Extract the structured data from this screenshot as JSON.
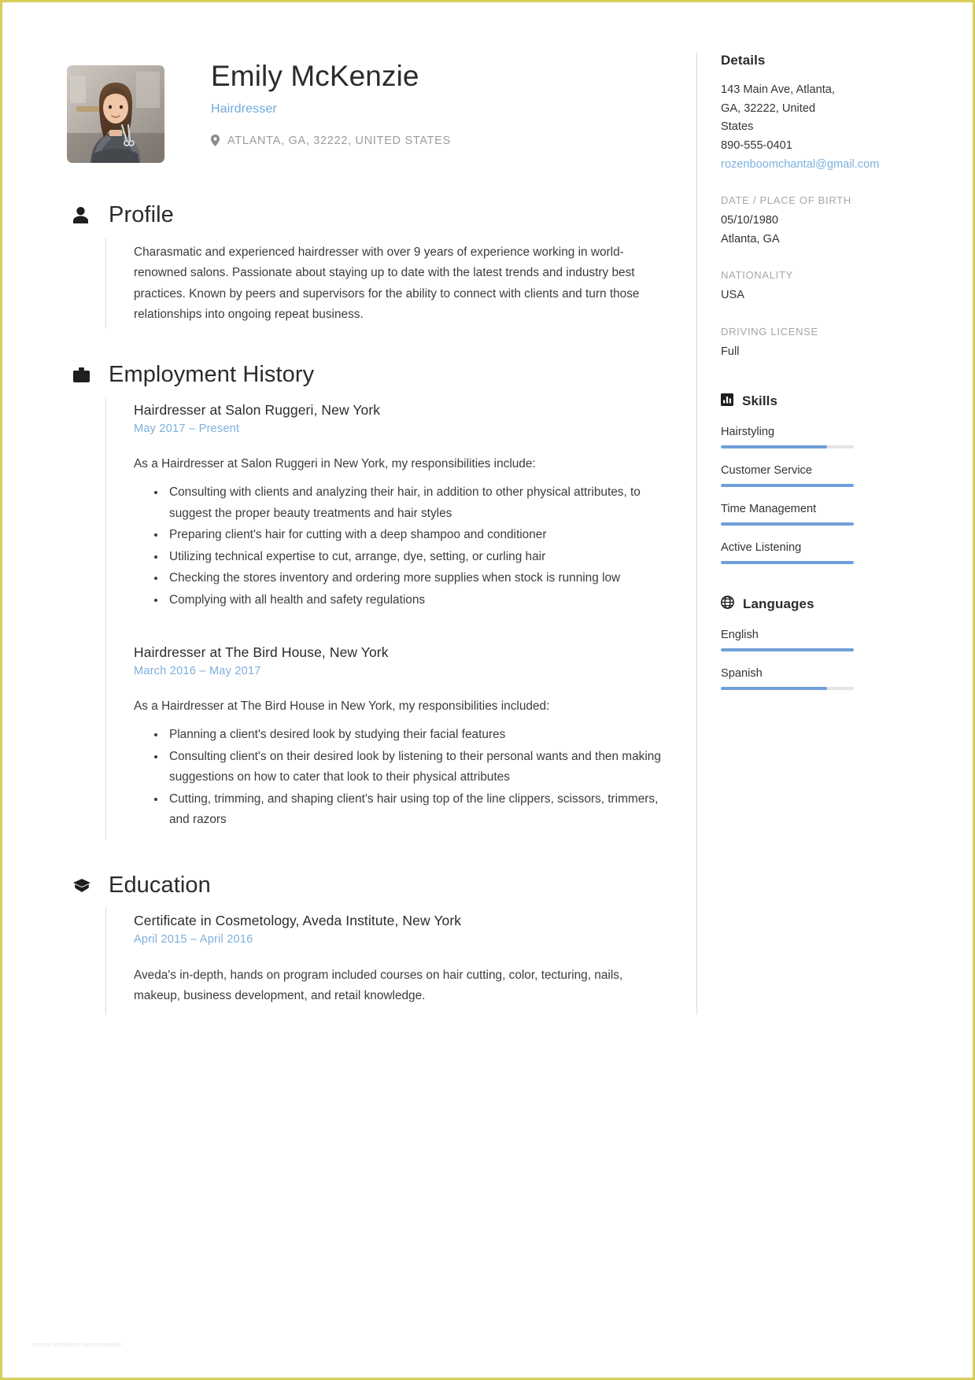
{
  "header": {
    "name": "Emily McKenzie",
    "job_title": "Hairdresser",
    "location": "ATLANTA, GA, 32222, UNITED STATES",
    "photo_alt": "portrait-photo"
  },
  "sections": {
    "profile": {
      "title": "Profile",
      "icon": "person-icon",
      "text": "Charasmatic and experienced hairdresser with over 9 years of experience working in world-renowned salons. Passionate about staying up to date with the latest trends and industry best practices. Known by peers and supervisors for the ability to connect with clients and turn those relationships into ongoing repeat business."
    },
    "employment": {
      "title": "Employment History",
      "icon": "briefcase-icon",
      "entries": [
        {
          "title": "Hairdresser at Salon Ruggeri, New York",
          "start": "May 2017",
          "dash": "–",
          "end": "Present",
          "lead": "As a Hairdresser at Salon Ruggeri in New York, my responsibilities include:",
          "bullets": [
            "Consulting with clients and analyzing their hair, in addition to other physical attributes, to suggest the proper beauty treatments and hair styles",
            "Preparing client's hair for cutting with a deep shampoo and conditioner",
            "Utilizing technical expertise to cut, arrange, dye, setting, or curling hair",
            "Checking the stores inventory and ordering more supplies when stock is running low",
            "Complying with all health and safety regulations"
          ]
        },
        {
          "title": "Hairdresser at The Bird House, New York",
          "start": "March 2016",
          "dash": "–",
          "end": "May 2017",
          "lead": "As a Hairdresser at The Bird House in New York, my responsibilities included:",
          "bullets": [
            "Planning a client's desired look by studying their facial features",
            "Consulting client's on their desired look by listening to their personal wants and then making suggestions on how to cater that look to their physical attributes",
            "Cutting, trimming, and shaping client's hair using top of the line clippers, scissors, trimmers, and razors"
          ]
        }
      ]
    },
    "education": {
      "title": "Education",
      "icon": "graduation-cap-icon",
      "entries": [
        {
          "title": "Certificate in Cosmetology, Aveda Institute, New York",
          "start": "April 2015",
          "dash": "–",
          "end": "April 2016",
          "description": "Aveda's in-depth, hands on program included courses on hair cutting, color, tecturing, nails, makeup, business development, and retail knowledge."
        }
      ]
    }
  },
  "sidebar": {
    "details": {
      "title": "Details",
      "address_lines": [
        "143 Main Ave, Atlanta,",
        "GA, 32222, United",
        "States"
      ],
      "phone": "890-555-0401",
      "email": "rozenboomchantal@gmail.com",
      "fields": [
        {
          "label": "DATE / PLACE OF BIRTH",
          "values": [
            "05/10/1980",
            "Atlanta, GA"
          ]
        },
        {
          "label": "NATIONALITY",
          "values": [
            "USA"
          ]
        },
        {
          "label": "DRIVING LICENSE",
          "values": [
            "Full"
          ]
        }
      ]
    },
    "skills": {
      "title": "Skills",
      "icon": "bar-chart-icon",
      "items": [
        {
          "name": "Hairstyling",
          "level": 80
        },
        {
          "name": "Customer Service",
          "level": 100
        },
        {
          "name": "Time Management",
          "level": 100
        },
        {
          "name": "Active Listening",
          "level": 100
        }
      ]
    },
    "languages": {
      "title": "Languages",
      "icon": "globe-icon",
      "items": [
        {
          "name": "English",
          "level": 100
        },
        {
          "name": "Spanish",
          "level": 80
        }
      ]
    }
  },
  "colors": {
    "accent": "#7db0dd",
    "bar_fill": "#6f9fd8",
    "bar_track": "#e4e4e4",
    "text": "#3c3c3c",
    "muted": "#a6a6a6",
    "page_border": "#d8cf5a"
  },
  "watermark": "resume templates layout example"
}
